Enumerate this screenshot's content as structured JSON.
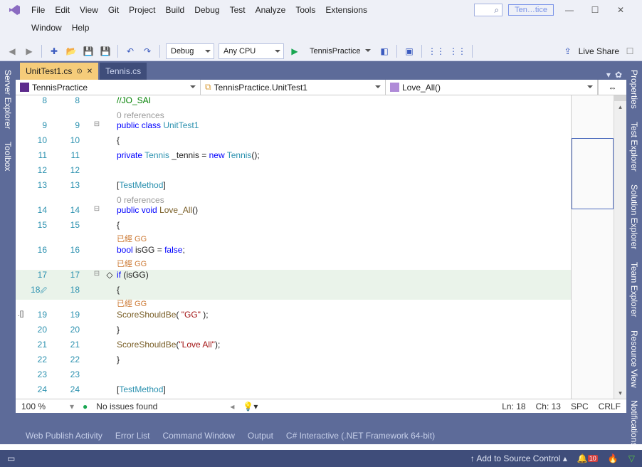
{
  "menu": {
    "file": "File",
    "edit": "Edit",
    "view": "View",
    "git": "Git",
    "project": "Project",
    "build": "Build",
    "debug": "Debug",
    "test": "Test",
    "analyze": "Analyze",
    "tools": "Tools",
    "extensions": "Extensions",
    "window": "Window",
    "help": "Help"
  },
  "title": {
    "solution_short": "Ten…tice"
  },
  "toolbar": {
    "config": "Debug",
    "platform": "Any CPU",
    "run_target": "TennisPractice",
    "live_share": "Live Share"
  },
  "left_wells": [
    "Server Explorer",
    "Toolbox"
  ],
  "right_wells": [
    "Properties",
    "Test Explorer",
    "Solution Explorer",
    "Team Explorer",
    "Resource View",
    "Notifications"
  ],
  "tabs": {
    "active": "UnitTest1.cs",
    "inactive": "Tennis.cs"
  },
  "nav": {
    "project": "TennisPractice",
    "type": "TennisPractice.UnitTest1",
    "member": "Love_All()"
  },
  "code": {
    "comment_author": "//JO_SAI",
    "ref0": "0 references",
    "l9": [
      "public",
      "class",
      "UnitTest1"
    ],
    "l10": "{",
    "l11": [
      "private",
      "Tennis",
      "_tennis",
      "=",
      "new",
      "Tennis",
      "();"
    ],
    "ref1": "0 references",
    "l13": [
      "[",
      "TestMethod",
      "]"
    ],
    "l14": [
      "public",
      "void",
      "Love_All",
      "()"
    ],
    "l15": "{",
    "annot16": "已經 GG",
    "l16": [
      "bool",
      "isGG",
      "=",
      "false",
      ";"
    ],
    "annot17": "已經 GG",
    "l17": [
      "if",
      "(",
      "isGG",
      ")"
    ],
    "l18": "{",
    "annot19": "已經 GG",
    "l19": [
      "ScoreShouldBe",
      "(",
      "\"GG\"",
      ");"
    ],
    "l20": "}",
    "l21": [
      "ScoreShouldBe",
      "(",
      "\"Love All\"",
      ");"
    ],
    "l22": "}",
    "l24": [
      "[",
      "TestMethod",
      "]"
    ]
  },
  "lines": [
    8,
    9,
    10,
    11,
    12,
    13,
    14,
    15,
    16,
    17,
    18,
    19,
    20,
    21,
    22,
    23,
    24
  ],
  "status": {
    "zoom": "100 %",
    "issues": "No issues found",
    "ln": "Ln: 18",
    "ch": "Ch: 13",
    "ins": "SPC",
    "eol": "CRLF"
  },
  "bottom_tabs": [
    "Web Publish Activity",
    "Error List",
    "Command Window",
    "Output",
    "C# Interactive (.NET Framework 64-bit)"
  ],
  "status_bar": {
    "source_control": "Add to Source Control",
    "notif_count": "10"
  }
}
